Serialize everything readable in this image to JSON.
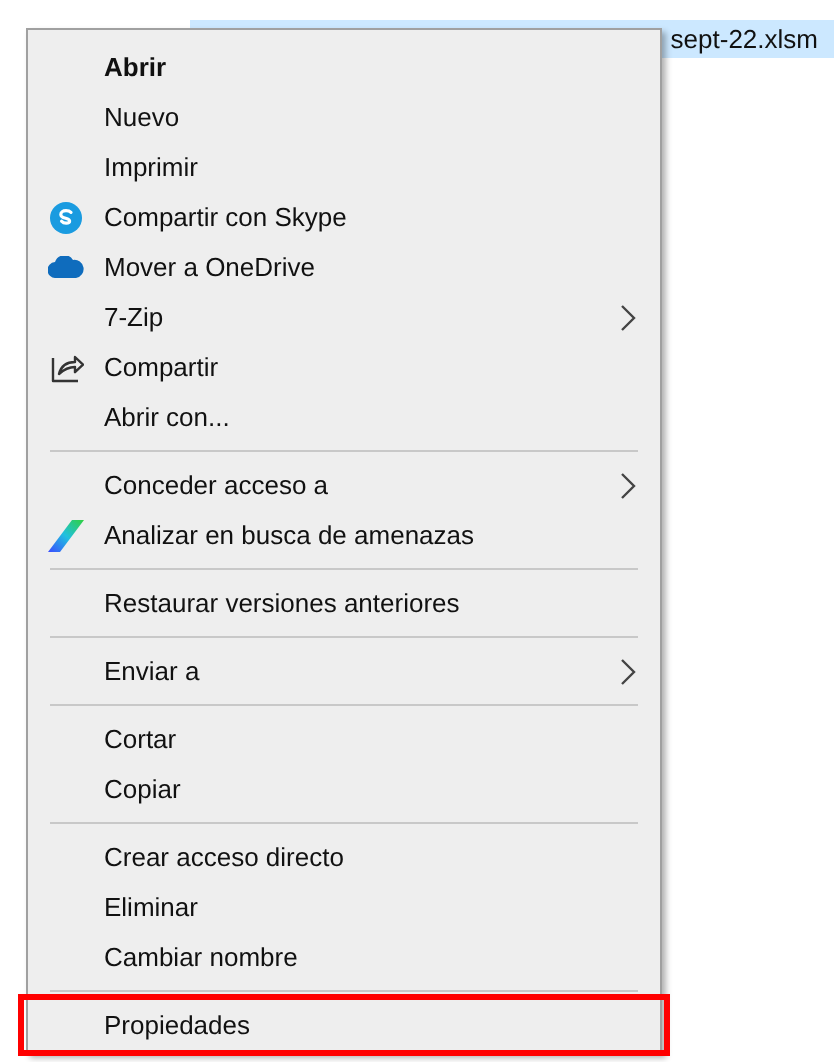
{
  "file_row": {
    "name": "sept-22.xlsm",
    "selected": true
  },
  "context_menu": {
    "items": [
      {
        "kind": "item",
        "label": "Abrir",
        "default": true,
        "submenu": false,
        "highlighted": false
      },
      {
        "kind": "item",
        "label": "Nuevo",
        "default": false,
        "submenu": false,
        "highlighted": false
      },
      {
        "kind": "item",
        "label": "Imprimir",
        "default": false,
        "submenu": false,
        "highlighted": false
      },
      {
        "kind": "item",
        "label": "Compartir con Skype",
        "default": false,
        "submenu": false,
        "highlighted": false
      },
      {
        "kind": "item",
        "label": "Mover a OneDrive",
        "default": false,
        "submenu": false,
        "highlighted": false
      },
      {
        "kind": "item",
        "label": "7-Zip",
        "default": false,
        "submenu": true,
        "highlighted": false
      },
      {
        "kind": "item",
        "label": "Compartir",
        "default": false,
        "submenu": false,
        "highlighted": false
      },
      {
        "kind": "item",
        "label": "Abrir con...",
        "default": false,
        "submenu": false,
        "highlighted": false
      },
      {
        "kind": "separator"
      },
      {
        "kind": "item",
        "label": "Conceder acceso a",
        "default": false,
        "submenu": true,
        "highlighted": false
      },
      {
        "kind": "item",
        "label": "Analizar en busca de amenazas",
        "default": false,
        "submenu": false,
        "highlighted": false
      },
      {
        "kind": "separator"
      },
      {
        "kind": "item",
        "label": "Restaurar versiones anteriores",
        "default": false,
        "submenu": false,
        "highlighted": false
      },
      {
        "kind": "separator"
      },
      {
        "kind": "item",
        "label": "Enviar a",
        "default": false,
        "submenu": true,
        "highlighted": false
      },
      {
        "kind": "separator"
      },
      {
        "kind": "item",
        "label": "Cortar",
        "default": false,
        "submenu": false,
        "highlighted": false
      },
      {
        "kind": "item",
        "label": "Copiar",
        "default": false,
        "submenu": false,
        "highlighted": false
      },
      {
        "kind": "separator"
      },
      {
        "kind": "item",
        "label": "Crear acceso directo",
        "default": false,
        "submenu": false,
        "highlighted": false
      },
      {
        "kind": "item",
        "label": "Eliminar",
        "default": false,
        "submenu": false,
        "highlighted": false
      },
      {
        "kind": "item",
        "label": "Cambiar nombre",
        "default": false,
        "submenu": false,
        "highlighted": false
      },
      {
        "kind": "separator"
      },
      {
        "kind": "item",
        "label": "Propiedades",
        "default": false,
        "submenu": false,
        "highlighted": true
      }
    ]
  }
}
